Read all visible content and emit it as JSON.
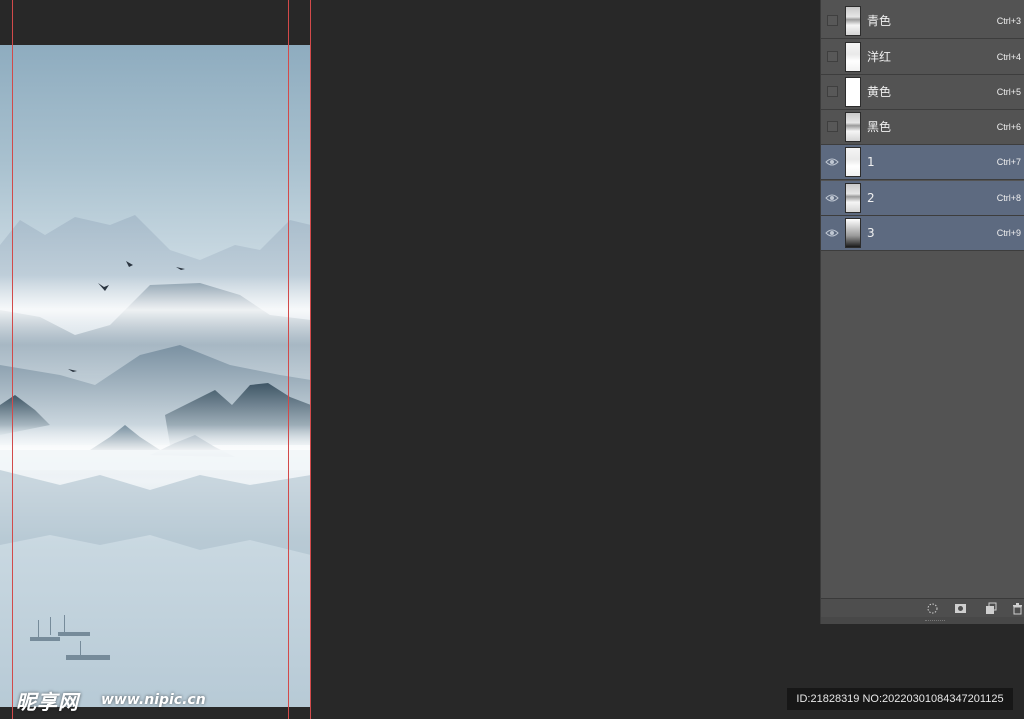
{
  "channels": [
    {
      "label": "青色",
      "shortcut": "Ctrl+3",
      "visible": false,
      "selected": false,
      "thumb": "landscape"
    },
    {
      "label": "洋红",
      "shortcut": "Ctrl+4",
      "visible": false,
      "selected": false,
      "thumb": "light"
    },
    {
      "label": "黄色",
      "shortcut": "Ctrl+5",
      "visible": false,
      "selected": false,
      "thumb": "white"
    },
    {
      "label": "黑色",
      "shortcut": "Ctrl+6",
      "visible": false,
      "selected": false,
      "thumb": "landscape"
    },
    {
      "label": "1",
      "shortcut": "Ctrl+7",
      "visible": true,
      "selected": true,
      "thumb": "light"
    },
    {
      "label": "2",
      "shortcut": "Ctrl+8",
      "visible": true,
      "selected": true,
      "thumb": "landscape"
    },
    {
      "label": "3",
      "shortcut": "Ctrl+9",
      "visible": true,
      "selected": true,
      "thumb": "gradient"
    }
  ],
  "footer_icons": [
    "load-selection-icon",
    "save-selection-icon",
    "new-channel-icon",
    "delete-channel-icon"
  ],
  "watermark": {
    "logo": "昵享网",
    "site": "www.nipic.cn",
    "id_text": "ID:21828319 NO:20220301084347201125"
  },
  "colors": {
    "workspace": "#282828",
    "panel": "#535353",
    "selected_row": "#5d6a80",
    "guide": "#d24a4a"
  }
}
